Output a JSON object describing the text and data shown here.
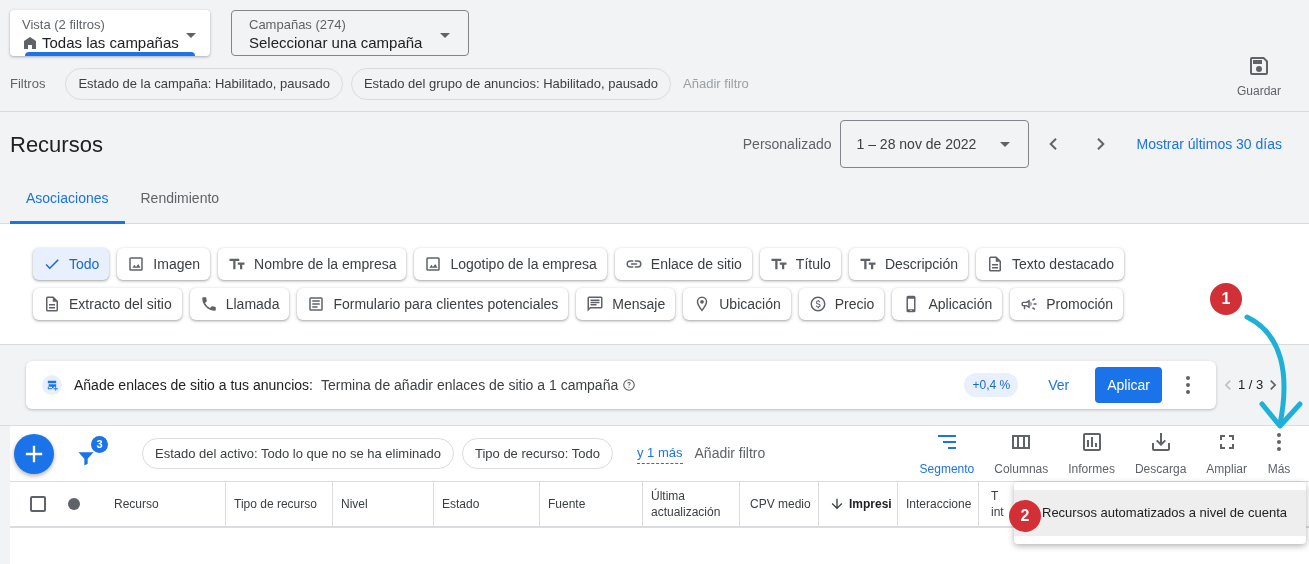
{
  "view_select": {
    "label": "Vista (2 filtros)",
    "value": "Todas las campañas"
  },
  "campaign_select": {
    "label": "Campañas (274)",
    "value": "Seleccionar una campaña"
  },
  "filters": {
    "label": "Filtros",
    "chips": [
      "Estado de la campaña: Habilitado, pausado",
      "Estado del grupo de anuncios: Habilitado, pausado"
    ],
    "add": "Añadir filtro"
  },
  "save": {
    "label": "Guardar"
  },
  "page_title": "Recursos",
  "date": {
    "label": "Personalizado",
    "value": "1 – 28 nov de 2022",
    "link": "Mostrar últimos 30 días"
  },
  "tabs": [
    {
      "label": "Asociaciones",
      "selected": true
    },
    {
      "label": "Rendimiento",
      "selected": false
    }
  ],
  "asset_type_rows": [
    {
      "items": [
        {
          "label": "Todo",
          "selected": true
        },
        {
          "label": "Imagen",
          "selected": false
        },
        {
          "label": "Nombre de la empresa",
          "selected": false
        },
        {
          "label": "Logotipo de la empresa",
          "selected": false
        },
        {
          "label": "Enlace de sitio",
          "selected": false
        },
        {
          "label": "Título",
          "selected": false
        },
        {
          "label": "Descripción",
          "selected": false
        },
        {
          "label": "Texto destacado",
          "selected": false
        }
      ]
    },
    {
      "items": [
        {
          "label": "Extracto del sitio",
          "selected": false
        },
        {
          "label": "Llamada",
          "selected": false
        },
        {
          "label": "Formulario para clientes potenciales",
          "selected": false
        },
        {
          "label": "Mensaje",
          "selected": false
        },
        {
          "label": "Ubicación",
          "selected": false
        },
        {
          "label": "Precio",
          "selected": false
        },
        {
          "label": "Aplicación",
          "selected": false
        },
        {
          "label": "Promoción",
          "selected": false
        }
      ]
    }
  ],
  "recommendation": {
    "title": "Añade enlaces de sitio a tus anuncios:",
    "text": "Termina de añadir enlaces de sitio a 1 campaña",
    "uplift": "+0,4 %",
    "view": "Ver",
    "apply": "Aplicar",
    "pager": "1 / 3"
  },
  "toolbar": {
    "filter_count": "3",
    "chips": [
      "Estado del activo: Todo lo que no se ha eliminado",
      "Tipo de recurso: Todo"
    ],
    "more_link": "y 1 más",
    "add_filter": "Añadir filtro",
    "actions": [
      {
        "label": "Segmento",
        "selected": true
      },
      {
        "label": "Columnas",
        "selected": false
      },
      {
        "label": "Informes",
        "selected": false
      },
      {
        "label": "Descarga",
        "selected": false
      },
      {
        "label": "Ampliar",
        "selected": false
      },
      {
        "label": "Más",
        "selected": false
      }
    ]
  },
  "table": {
    "select_all": {
      "checked": false
    },
    "columns": [
      {
        "lines": [
          "Recurso"
        ]
      },
      {
        "lines": [
          "Tipo de recurso"
        ]
      },
      {
        "lines": [
          "Nivel"
        ]
      },
      {
        "lines": [
          "Estado"
        ]
      },
      {
        "lines": [
          "Fuente"
        ]
      },
      {
        "lines": [
          "Última",
          "actualización"
        ]
      },
      {
        "lines": [
          "CPV medio"
        ]
      },
      {
        "lines": [
          "Impresi"
        ],
        "sorted": true
      },
      {
        "lines": [
          "Interaccione"
        ]
      },
      {
        "lines": [
          "T",
          "int"
        ]
      }
    ]
  },
  "more_menu": {
    "items": [
      "Recursos automatizados a nivel de cuenta"
    ]
  },
  "annotations": [
    {
      "label": "1"
    },
    {
      "label": "2"
    }
  ]
}
